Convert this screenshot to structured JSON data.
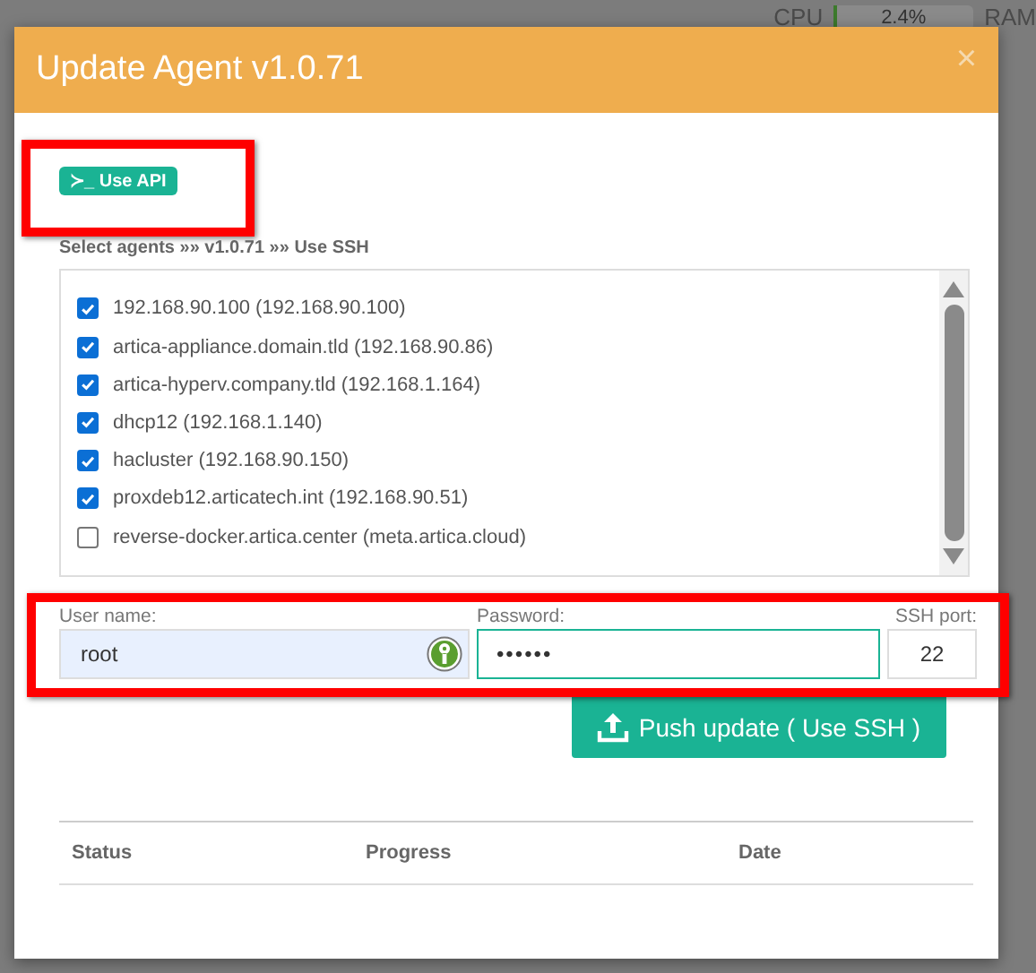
{
  "background": {
    "cpu_label": "CPU",
    "cpu_meter": {
      "reading": "2.4%",
      "level": 0.03
    },
    "ram_label": "RAM"
  },
  "dialog": {
    "title": "Update Agent v1.0.71",
    "close": "×"
  },
  "api_button": {
    "icon": "≻_",
    "label": "Use API"
  },
  "breadcrumb": "Select agents »» v1.0.71 »» Use SSH",
  "agents": [
    {
      "label": "192.168.90.100 (192.168.90.100)",
      "checked": true
    },
    {
      "label": "artica-appliance.domain.tld (192.168.90.86)",
      "checked": true
    },
    {
      "label": "artica-hyperv.company.tld (192.168.1.164)",
      "checked": true
    },
    {
      "label": "dhcp12 (192.168.1.140)",
      "checked": true
    },
    {
      "label": "hacluster (192.168.90.150)",
      "checked": true
    },
    {
      "label": "proxdeb12.articatech.int (192.168.90.51)",
      "checked": true
    },
    {
      "label": "reverse-docker.artica.center (meta.artica.cloud)",
      "checked": false
    }
  ],
  "fields": [
    {
      "label": "User name:",
      "value": "root",
      "kind": "user"
    },
    {
      "label": "Password:",
      "value": "••••••",
      "kind": "password"
    },
    {
      "label": "SSH port:",
      "value": "22",
      "kind": "port"
    }
  ],
  "push_button": "Push update ( Use SSH )",
  "table": {
    "columns": [
      "Status",
      "Progress",
      "Date"
    ]
  }
}
